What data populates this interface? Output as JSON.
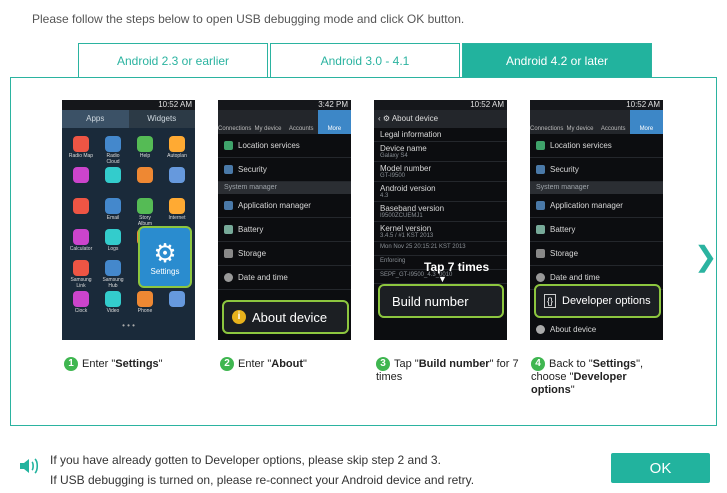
{
  "instruction": "Please follow the steps below to open USB debugging mode and click OK button.",
  "tabs": [
    {
      "label": "Android 2.3 or earlier"
    },
    {
      "label": "Android 3.0 - 4.1"
    },
    {
      "label": "Android 4.2 or later",
      "active": true
    }
  ],
  "phones": {
    "time1": "10:52 AM",
    "time2": "3:42 PM",
    "time3": "10:52 AM",
    "time4": "10:52 AM",
    "p1": {
      "tabs": [
        "Apps",
        "Widgets"
      ],
      "apps": [
        "Radio Map",
        "Radio Cloud",
        "Help",
        "Autoplan",
        "",
        "",
        "",
        "",
        "",
        "Email",
        "Story Album",
        "Internet",
        "Calculator",
        "Logs",
        "",
        "",
        "Samsung Link",
        "Samsung Hub",
        "Settings",
        "",
        "Clock",
        "Video",
        "Phone",
        ""
      ],
      "settings_label": "Settings"
    },
    "p2": {
      "tabs": [
        "Connections",
        "My device",
        "Accounts",
        "More"
      ],
      "rows": [
        "Location services",
        "Security"
      ],
      "section": "System manager",
      "rows2": [
        "Application manager",
        "Battery",
        "Storage",
        "Date and time"
      ],
      "callout": "About device"
    },
    "p3": {
      "header": "About device",
      "rows": [
        {
          "t": "Legal information",
          "s": ""
        },
        {
          "t": "Device name",
          "s": "Galaxy S4"
        },
        {
          "t": "Model number",
          "s": "GT-I9500"
        },
        {
          "t": "Android version",
          "s": "4.3"
        },
        {
          "t": "Baseband version",
          "s": "I9500ZCUEMJ1"
        },
        {
          "t": "Kernel version",
          "s": "3.4.5 / #1 KST 2013"
        },
        {
          "t": "",
          "s": "Mon Nov 25 20:15:21 KST 2013"
        },
        {
          "t": "",
          "s": "Enforcing"
        },
        {
          "t": "",
          "s": "SEPF_GT-I9500_4.3_0010"
        }
      ],
      "tap_label": "Tap 7 times",
      "callout": "Build number"
    },
    "p4": {
      "tabs": [
        "Connections",
        "My device",
        "Accounts",
        "More"
      ],
      "rows": [
        "Location services",
        "Security"
      ],
      "section": "System manager",
      "rows2": [
        "Application manager",
        "Battery",
        "Storage",
        "Date and time"
      ],
      "callout": "Developer options",
      "last": "About device"
    }
  },
  "steps": [
    {
      "n": "1",
      "pre": "Enter \"",
      "bold": "Settings",
      "post": "\""
    },
    {
      "n": "2",
      "pre": "Enter \"",
      "bold": "About",
      "post": "\""
    },
    {
      "n": "3",
      "pre": "Tap \"",
      "bold": "Build number",
      "post": "\" for 7 times"
    },
    {
      "n": "4",
      "pre": "Back to \"",
      "bold": "Settings",
      "post": "\", choose \"",
      "bold2": "Developer options",
      "post2": "\""
    }
  ],
  "footer": {
    "line1": "If you have already gotten to Developer options, please skip step 2 and 3.",
    "line2": "If USB debugging is turned on, please re-connect your Android device and retry."
  },
  "ok_label": "OK",
  "colors": {
    "accent": "#22b39e",
    "step_num": "#3fb650",
    "callout_border": "#8dc63f"
  }
}
